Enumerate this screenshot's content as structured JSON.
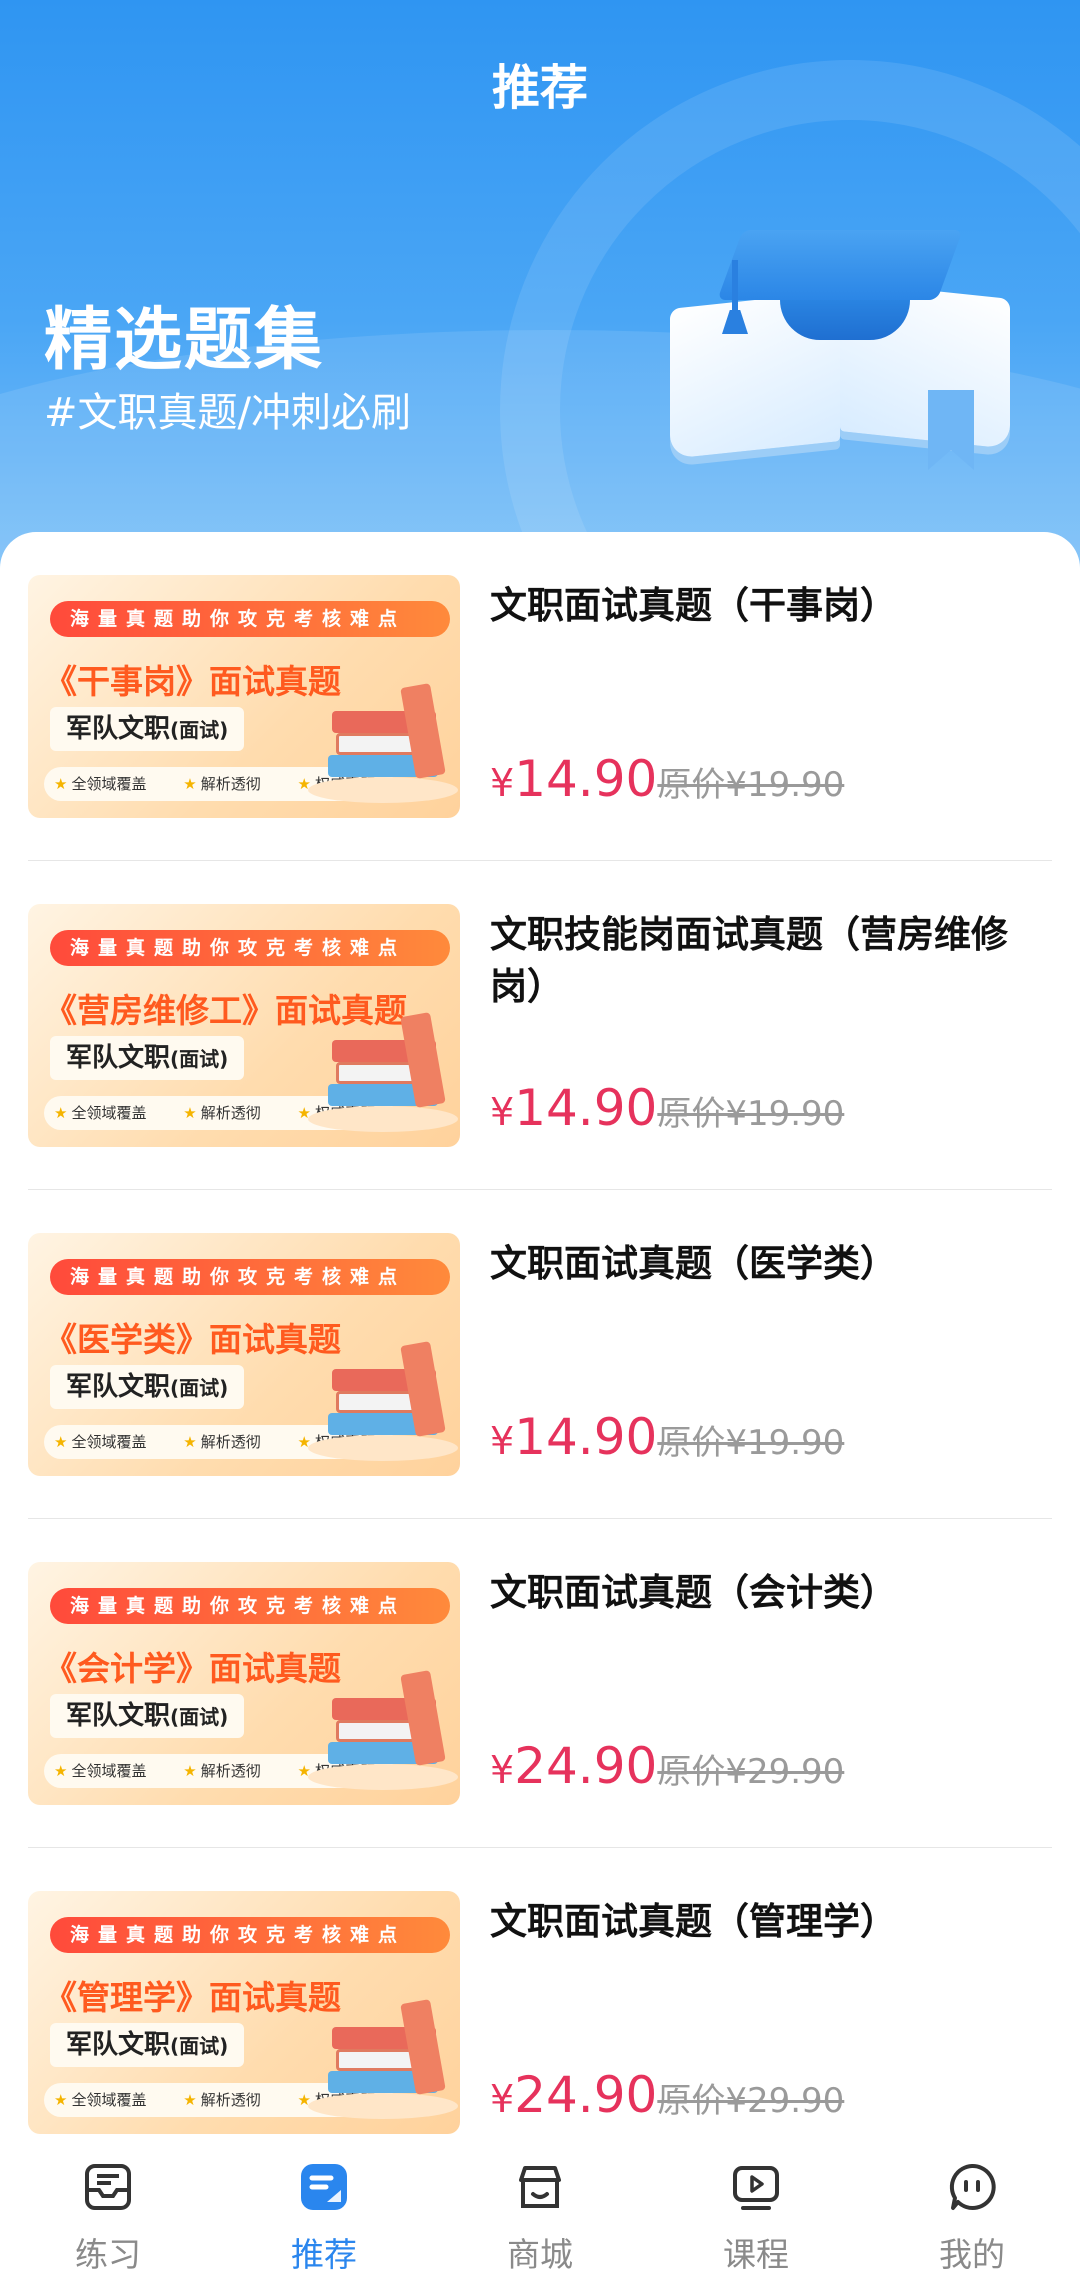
{
  "header": {
    "page_title": "推荐",
    "hero_title": "精选题集",
    "hero_subtitle": "#文职真题/冲刺必刷"
  },
  "thumb_common": {
    "ribbon": "海量真题助你攻克考核难点",
    "brand": "军队文职",
    "brand_suffix": "(面试)",
    "features": [
      "全领域覆盖",
      "解析透彻",
      "权威真题"
    ]
  },
  "items": [
    {
      "thumb_headline": "《干事岗》面试真题",
      "title": "文职面试真题（干事岗）",
      "currency": "¥",
      "price": "14.90",
      "original_price": "原价¥19.90"
    },
    {
      "thumb_headline": "《营房维修工》面试真题",
      "title": "文职技能岗面试真题（营房维修岗）",
      "currency": "¥",
      "price": "14.90",
      "original_price": "原价¥19.90"
    },
    {
      "thumb_headline": "《医学类》面试真题",
      "title": "文职面试真题（医学类）",
      "currency": "¥",
      "price": "14.90",
      "original_price": "原价¥19.90"
    },
    {
      "thumb_headline": "《会计学》面试真题",
      "title": "文职面试真题（会计类）",
      "currency": "¥",
      "price": "24.90",
      "original_price": "原价¥29.90"
    },
    {
      "thumb_headline": "《管理学》面试真题",
      "title": "文职面试真题（管理学）",
      "currency": "¥",
      "price": "24.90",
      "original_price": "原价¥29.90"
    }
  ],
  "nav": {
    "items": [
      {
        "label": "练习",
        "icon": "practice-icon"
      },
      {
        "label": "推荐",
        "icon": "recommend-icon",
        "active": true
      },
      {
        "label": "商城",
        "icon": "store-icon"
      },
      {
        "label": "课程",
        "icon": "course-icon"
      },
      {
        "label": "我的",
        "icon": "profile-icon"
      }
    ]
  },
  "colors": {
    "header_blue": "#2f95f2",
    "price_red": "#e6325c",
    "nav_active": "#2a86ee",
    "nav_inactive": "#8a8a8a"
  }
}
